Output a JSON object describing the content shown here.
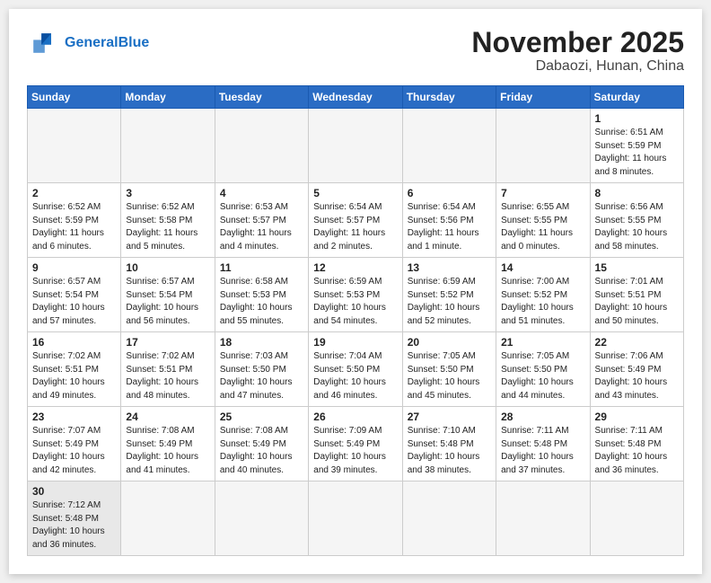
{
  "header": {
    "logo_line1": "General",
    "logo_line2": "Blue",
    "month": "November 2025",
    "location": "Dabaozi, Hunan, China"
  },
  "weekdays": [
    "Sunday",
    "Monday",
    "Tuesday",
    "Wednesday",
    "Thursday",
    "Friday",
    "Saturday"
  ],
  "weeks": [
    [
      {
        "day": "",
        "info": ""
      },
      {
        "day": "",
        "info": ""
      },
      {
        "day": "",
        "info": ""
      },
      {
        "day": "",
        "info": ""
      },
      {
        "day": "",
        "info": ""
      },
      {
        "day": "",
        "info": ""
      },
      {
        "day": "1",
        "info": "Sunrise: 6:51 AM\nSunset: 5:59 PM\nDaylight: 11 hours\nand 8 minutes."
      }
    ],
    [
      {
        "day": "2",
        "info": "Sunrise: 6:52 AM\nSunset: 5:59 PM\nDaylight: 11 hours\nand 6 minutes."
      },
      {
        "day": "3",
        "info": "Sunrise: 6:52 AM\nSunset: 5:58 PM\nDaylight: 11 hours\nand 5 minutes."
      },
      {
        "day": "4",
        "info": "Sunrise: 6:53 AM\nSunset: 5:57 PM\nDaylight: 11 hours\nand 4 minutes."
      },
      {
        "day": "5",
        "info": "Sunrise: 6:54 AM\nSunset: 5:57 PM\nDaylight: 11 hours\nand 2 minutes."
      },
      {
        "day": "6",
        "info": "Sunrise: 6:54 AM\nSunset: 5:56 PM\nDaylight: 11 hours\nand 1 minute."
      },
      {
        "day": "7",
        "info": "Sunrise: 6:55 AM\nSunset: 5:55 PM\nDaylight: 11 hours\nand 0 minutes."
      },
      {
        "day": "8",
        "info": "Sunrise: 6:56 AM\nSunset: 5:55 PM\nDaylight: 10 hours\nand 58 minutes."
      }
    ],
    [
      {
        "day": "9",
        "info": "Sunrise: 6:57 AM\nSunset: 5:54 PM\nDaylight: 10 hours\nand 57 minutes."
      },
      {
        "day": "10",
        "info": "Sunrise: 6:57 AM\nSunset: 5:54 PM\nDaylight: 10 hours\nand 56 minutes."
      },
      {
        "day": "11",
        "info": "Sunrise: 6:58 AM\nSunset: 5:53 PM\nDaylight: 10 hours\nand 55 minutes."
      },
      {
        "day": "12",
        "info": "Sunrise: 6:59 AM\nSunset: 5:53 PM\nDaylight: 10 hours\nand 54 minutes."
      },
      {
        "day": "13",
        "info": "Sunrise: 6:59 AM\nSunset: 5:52 PM\nDaylight: 10 hours\nand 52 minutes."
      },
      {
        "day": "14",
        "info": "Sunrise: 7:00 AM\nSunset: 5:52 PM\nDaylight: 10 hours\nand 51 minutes."
      },
      {
        "day": "15",
        "info": "Sunrise: 7:01 AM\nSunset: 5:51 PM\nDaylight: 10 hours\nand 50 minutes."
      }
    ],
    [
      {
        "day": "16",
        "info": "Sunrise: 7:02 AM\nSunset: 5:51 PM\nDaylight: 10 hours\nand 49 minutes."
      },
      {
        "day": "17",
        "info": "Sunrise: 7:02 AM\nSunset: 5:51 PM\nDaylight: 10 hours\nand 48 minutes."
      },
      {
        "day": "18",
        "info": "Sunrise: 7:03 AM\nSunset: 5:50 PM\nDaylight: 10 hours\nand 47 minutes."
      },
      {
        "day": "19",
        "info": "Sunrise: 7:04 AM\nSunset: 5:50 PM\nDaylight: 10 hours\nand 46 minutes."
      },
      {
        "day": "20",
        "info": "Sunrise: 7:05 AM\nSunset: 5:50 PM\nDaylight: 10 hours\nand 45 minutes."
      },
      {
        "day": "21",
        "info": "Sunrise: 7:05 AM\nSunset: 5:50 PM\nDaylight: 10 hours\nand 44 minutes."
      },
      {
        "day": "22",
        "info": "Sunrise: 7:06 AM\nSunset: 5:49 PM\nDaylight: 10 hours\nand 43 minutes."
      }
    ],
    [
      {
        "day": "23",
        "info": "Sunrise: 7:07 AM\nSunset: 5:49 PM\nDaylight: 10 hours\nand 42 minutes."
      },
      {
        "day": "24",
        "info": "Sunrise: 7:08 AM\nSunset: 5:49 PM\nDaylight: 10 hours\nand 41 minutes."
      },
      {
        "day": "25",
        "info": "Sunrise: 7:08 AM\nSunset: 5:49 PM\nDaylight: 10 hours\nand 40 minutes."
      },
      {
        "day": "26",
        "info": "Sunrise: 7:09 AM\nSunset: 5:49 PM\nDaylight: 10 hours\nand 39 minutes."
      },
      {
        "day": "27",
        "info": "Sunrise: 7:10 AM\nSunset: 5:48 PM\nDaylight: 10 hours\nand 38 minutes."
      },
      {
        "day": "28",
        "info": "Sunrise: 7:11 AM\nSunset: 5:48 PM\nDaylight: 10 hours\nand 37 minutes."
      },
      {
        "day": "29",
        "info": "Sunrise: 7:11 AM\nSunset: 5:48 PM\nDaylight: 10 hours\nand 36 minutes."
      }
    ],
    [
      {
        "day": "30",
        "info": "Sunrise: 7:12 AM\nSunset: 5:48 PM\nDaylight: 10 hours\nand 36 minutes."
      },
      {
        "day": "",
        "info": ""
      },
      {
        "day": "",
        "info": ""
      },
      {
        "day": "",
        "info": ""
      },
      {
        "day": "",
        "info": ""
      },
      {
        "day": "",
        "info": ""
      },
      {
        "day": "",
        "info": ""
      }
    ]
  ]
}
